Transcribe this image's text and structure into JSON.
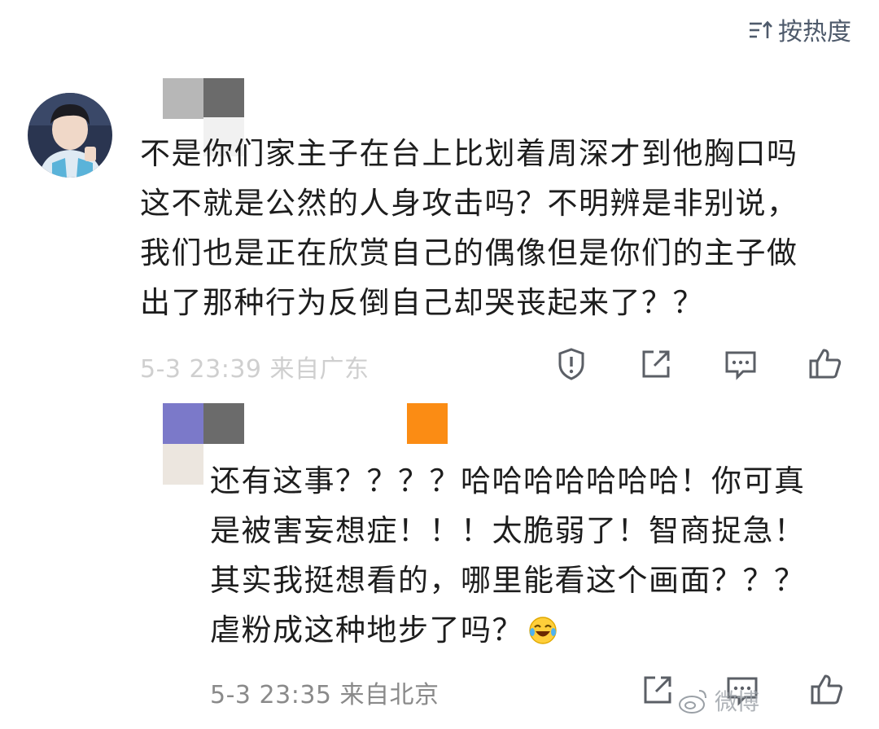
{
  "sort": {
    "icon": "sort-icon",
    "label": "按热度"
  },
  "colors": {
    "text": "#1d1d1d",
    "meta": "#8a8a8a",
    "icon": "#5b5f66",
    "sort": "#4e5a6b"
  },
  "comments": [
    {
      "avatar": "avatar-image",
      "text_lines": [
        "不是你们家主子在台上比划着周深才到他胸口吗",
        "这不就是公然的人身攻击吗？不明辨是非别说，",
        "我们也是正在欣赏自己的偶像但是你们的主子做",
        "出了那种行为反倒自己却哭丧起来了？？"
      ],
      "meta": "5-3 23:39 来自广东",
      "actions": [
        "report-icon",
        "share-icon",
        "reply-icon",
        "like-icon"
      ]
    },
    {
      "text_lines": [
        "还有这事？？？？哈哈哈哈哈哈哈！你可真",
        "是被害妄想症！！！太脆弱了！智商捉急！",
        "其实我挺想看的，哪里能看这个画面？？？",
        "虐粉成这种地步了吗？"
      ],
      "emoji": "laughing-crying-emoji",
      "meta": "5-3 23:35 来自北京",
      "actions": [
        "share-icon",
        "reply-icon",
        "like-icon"
      ]
    }
  ],
  "watermark": {
    "text": "微博"
  }
}
